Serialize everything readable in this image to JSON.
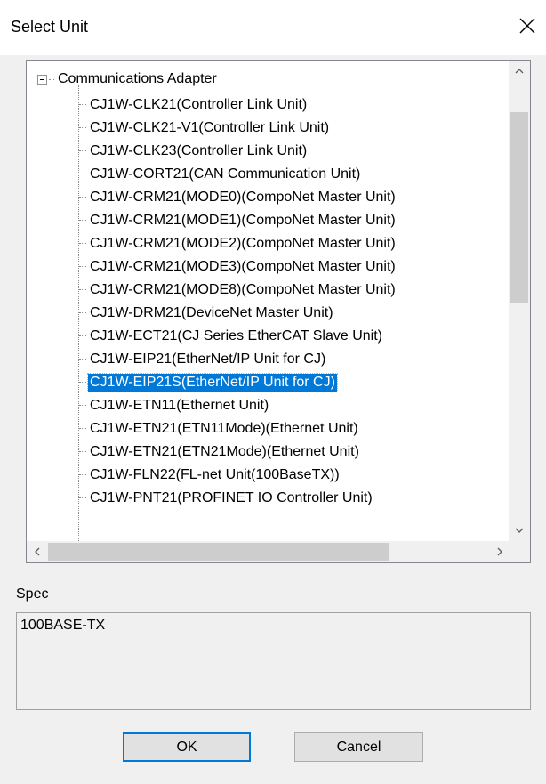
{
  "window": {
    "title": "Select Unit",
    "close_icon": "close-icon"
  },
  "tree": {
    "root": {
      "label": "Communications Adapter",
      "expanded": true,
      "expander_icon": "collapse-minus-icon"
    },
    "items": [
      {
        "label": "CJ1W-CLK21(Controller Link Unit)",
        "selected": false
      },
      {
        "label": "CJ1W-CLK21-V1(Controller Link Unit)",
        "selected": false
      },
      {
        "label": "CJ1W-CLK23(Controller Link Unit)",
        "selected": false
      },
      {
        "label": "CJ1W-CORT21(CAN Communication Unit)",
        "selected": false
      },
      {
        "label": "CJ1W-CRM21(MODE0)(CompoNet Master Unit)",
        "selected": false
      },
      {
        "label": "CJ1W-CRM21(MODE1)(CompoNet Master Unit)",
        "selected": false
      },
      {
        "label": "CJ1W-CRM21(MODE2)(CompoNet Master Unit)",
        "selected": false
      },
      {
        "label": "CJ1W-CRM21(MODE3)(CompoNet Master Unit)",
        "selected": false
      },
      {
        "label": "CJ1W-CRM21(MODE8)(CompoNet Master Unit)",
        "selected": false
      },
      {
        "label": "CJ1W-DRM21(DeviceNet Master Unit)",
        "selected": false
      },
      {
        "label": "CJ1W-ECT21(CJ Series EtherCAT Slave Unit)",
        "selected": false
      },
      {
        "label": "CJ1W-EIP21(EtherNet/IP Unit for CJ)",
        "selected": false
      },
      {
        "label": "CJ1W-EIP21S(EtherNet/IP Unit for CJ)",
        "selected": true
      },
      {
        "label": "CJ1W-ETN11(Ethernet Unit)",
        "selected": false
      },
      {
        "label": "CJ1W-ETN21(ETN11Mode)(Ethernet Unit)",
        "selected": false
      },
      {
        "label": "CJ1W-ETN21(ETN21Mode)(Ethernet Unit)",
        "selected": false
      },
      {
        "label": "CJ1W-FLN22(FL-net Unit(100BaseTX))",
        "selected": false
      },
      {
        "label": "CJ1W-PNT21(PROFINET IO Controller Unit)",
        "selected": false
      }
    ],
    "scrollbar_icons": {
      "up": "chevron-up-icon",
      "down": "chevron-down-icon",
      "left": "chevron-left-icon",
      "right": "chevron-right-icon"
    }
  },
  "spec": {
    "label": "Spec",
    "value": "100BASE-TX"
  },
  "buttons": {
    "ok": "OK",
    "cancel": "Cancel"
  },
  "colors": {
    "selection": "#0078d7",
    "selection_text": "#ffffff",
    "dialog_bg": "#f0f0f0",
    "default_button_border": "#0078d7"
  }
}
